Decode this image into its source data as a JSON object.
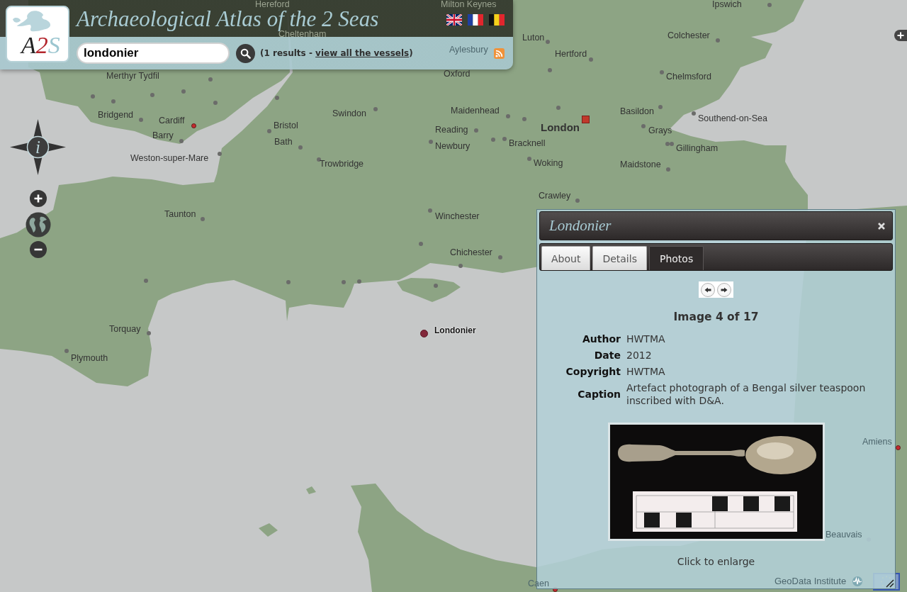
{
  "header": {
    "logo": {
      "letters": [
        "A",
        "2",
        "S"
      ]
    },
    "title": "Archaeological Atlas of the 2 Seas",
    "languages": [
      {
        "kind": "uk"
      },
      {
        "kind": "fr"
      },
      {
        "kind": "be"
      }
    ]
  },
  "search": {
    "value": "londonier",
    "results_prefix": "(1 results - ",
    "results_link": "view all the vessels",
    "results_suffix": ")"
  },
  "map": {
    "places": [
      {
        "name": "Hereford",
        "kind": "town"
      },
      {
        "name": "Milton Keynes",
        "kind": "town"
      },
      {
        "name": "Ipswich",
        "kind": "town"
      },
      {
        "name": "Cheltenham",
        "kind": "town"
      },
      {
        "name": "Luton",
        "kind": "town"
      },
      {
        "name": "Colchester",
        "kind": "town"
      },
      {
        "name": "Aylesbury",
        "kind": "town"
      },
      {
        "name": "Hertford",
        "kind": "town"
      },
      {
        "name": "Merthyr Tydfil",
        "kind": "town"
      },
      {
        "name": "Oxford",
        "kind": "town"
      },
      {
        "name": "Chelmsford",
        "kind": "town"
      },
      {
        "name": "Bridgend",
        "kind": "town"
      },
      {
        "name": "Swindon",
        "kind": "town"
      },
      {
        "name": "Maidenhead",
        "kind": "town"
      },
      {
        "name": "Basildon",
        "kind": "town"
      },
      {
        "name": "Cardiff",
        "kind": "site"
      },
      {
        "name": "Southend-on-Sea",
        "kind": "town"
      },
      {
        "name": "Bristol",
        "kind": "town"
      },
      {
        "name": "Reading",
        "kind": "town"
      },
      {
        "name": "London",
        "kind": "capital"
      },
      {
        "name": "Grays",
        "kind": "town"
      },
      {
        "name": "Barry",
        "kind": "town"
      },
      {
        "name": "Bath",
        "kind": "town"
      },
      {
        "name": "Newbury",
        "kind": "town"
      },
      {
        "name": "Bracknell",
        "kind": "town"
      },
      {
        "name": "Gillingham",
        "kind": "town"
      },
      {
        "name": "Weston-super-Mare",
        "kind": "town"
      },
      {
        "name": "Trowbridge",
        "kind": "town"
      },
      {
        "name": "Woking",
        "kind": "town"
      },
      {
        "name": "Maidstone",
        "kind": "town"
      },
      {
        "name": "Crawley",
        "kind": "town"
      },
      {
        "name": "Taunton",
        "kind": "town"
      },
      {
        "name": "Winchester",
        "kind": "town"
      },
      {
        "name": "Chichester",
        "kind": "town"
      },
      {
        "name": "Torquay",
        "kind": "town"
      },
      {
        "name": "Londonier",
        "kind": "vessel"
      },
      {
        "name": "Plymouth",
        "kind": "town"
      },
      {
        "name": "Amiens",
        "kind": "site"
      },
      {
        "name": "Beauvais",
        "kind": "town"
      },
      {
        "name": "Caen",
        "kind": "site"
      }
    ],
    "attribution": "GeoData Institute"
  },
  "map_controls": {
    "info_label": "i"
  },
  "popup": {
    "title": "Londonier",
    "tabs": [
      {
        "label": "About",
        "selected": false
      },
      {
        "label": "Details",
        "selected": false
      },
      {
        "label": "Photos",
        "selected": true
      }
    ],
    "image_counter": "Image 4 of 17",
    "fields": [
      {
        "label": "Author",
        "value": "HWTMA"
      },
      {
        "label": "Date",
        "value": "2012"
      },
      {
        "label": "Copyright",
        "value": "HWTMA"
      },
      {
        "label": "Caption",
        "value": "Artefact photograph of a Bengal silver teaspoon inscribed with D&A."
      }
    ],
    "hint": "Click to enlarge"
  }
}
